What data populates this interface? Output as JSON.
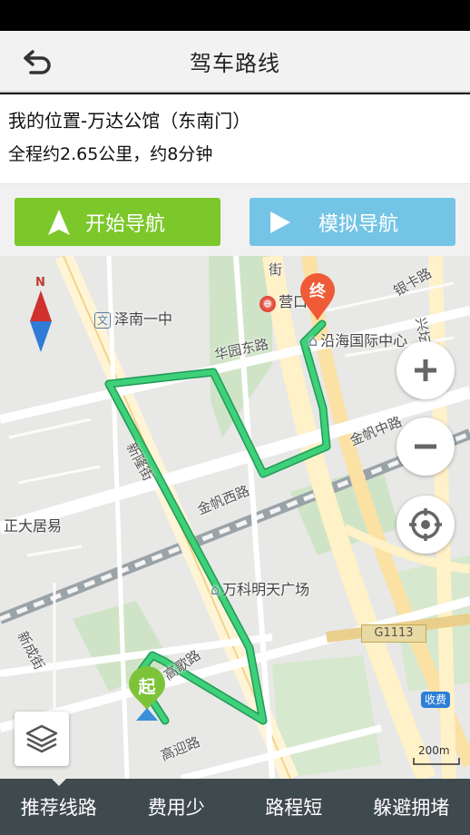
{
  "header": {
    "title": "驾车路线",
    "back_icon": "back-arrow-icon"
  },
  "route": {
    "from_to": "我的位置-万达公馆（东南门）",
    "summary": "全程约2.65公里，约8分钟"
  },
  "actions": {
    "start_nav": "开始导航",
    "simulate_nav": "模拟导航",
    "start_color": "#7cc72a",
    "simulate_color": "#74c4e6"
  },
  "map": {
    "pois": {
      "school": "泽南一中",
      "yingkou": "营口",
      "yanhai": "沿海国际中心",
      "zhengda": "正大居易",
      "wanke": "万科明天广场"
    },
    "roads": {
      "yinka": "银卡路",
      "huayuandong": "华园东路",
      "jinfanzhong": "金帆中路",
      "xinlong": "新隆街",
      "jinfanxi": "金帆西路",
      "gaoge": "高歌路",
      "xincheng": "新成街",
      "gaoying": "高迎路",
      "jie": "街",
      "xingtan": "兴坛南街",
      "highway": "G1113",
      "toll": "收费"
    },
    "markers": {
      "start": "起",
      "end": "终"
    },
    "compass_letter": "N",
    "scale": "200m",
    "route_color": "#3fd07a"
  },
  "tabs": [
    "推荐线路",
    "费用少",
    "路程短",
    "躲避拥堵"
  ]
}
